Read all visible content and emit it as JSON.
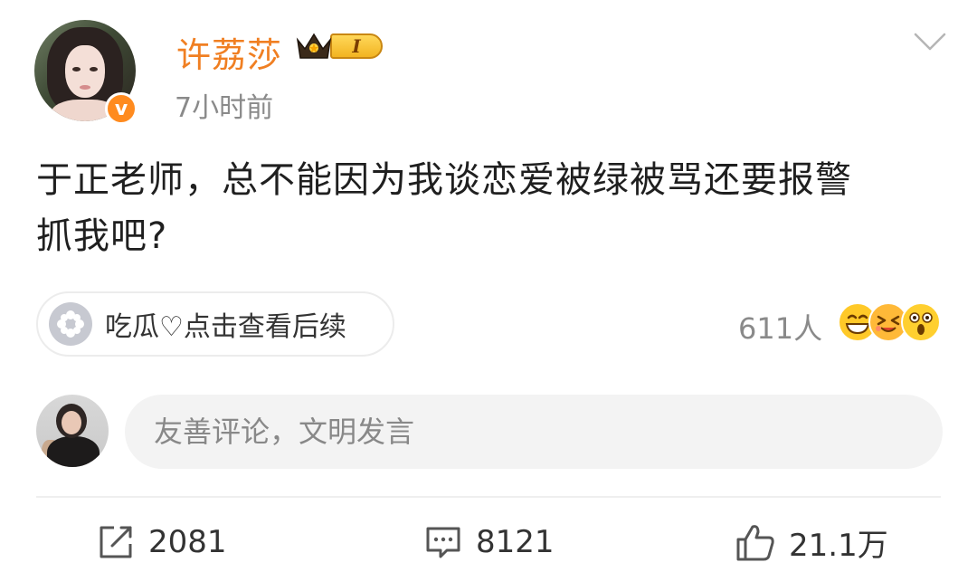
{
  "post": {
    "author": {
      "name": "许荔莎",
      "level_label": "I",
      "verified_mark": "v"
    },
    "timestamp": "7小时前",
    "text_line1": "于正老师，总不能因为我谈恋爱被绿被骂还要报警",
    "text_line2": "抓我吧?",
    "topic": {
      "label": "吃瓜♡点击查看后续",
      "icon": "flower-icon"
    },
    "reactions": {
      "count_label": "611人",
      "emoji_icons": [
        "grin-emoji-icon",
        "laughing-emoji-icon",
        "surprised-emoji-icon"
      ]
    }
  },
  "comment_box": {
    "placeholder": "友善评论，文明发言"
  },
  "actions": {
    "share_count": "2081",
    "comment_count": "8121",
    "like_count": "21.1万"
  },
  "colors": {
    "username": "#f07f22",
    "verified_badge": "#ff8b1f",
    "muted_text": "#8a8a8a",
    "body_text": "#1f1f1f",
    "input_bg": "#f3f3f3"
  }
}
